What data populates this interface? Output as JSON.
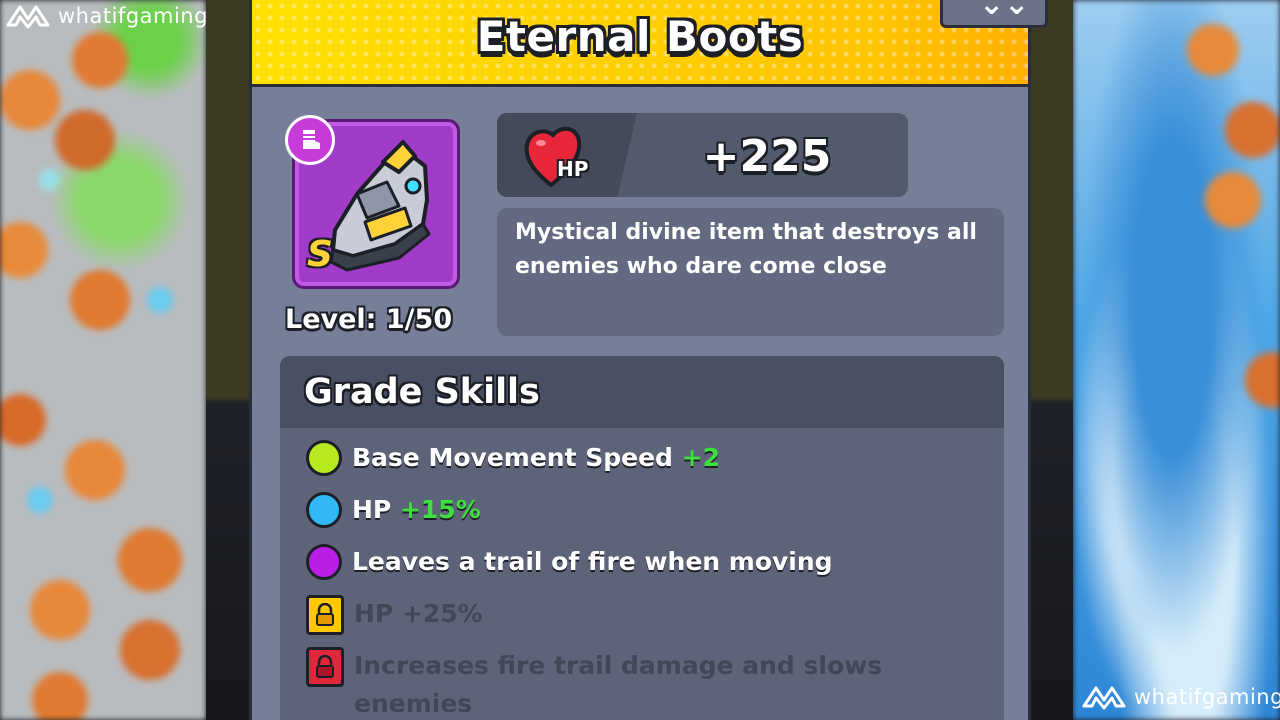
{
  "watermark": {
    "text": "whatifgaming"
  },
  "item": {
    "title": "Eternal Boots",
    "grade_letter": "S",
    "level_text": "Level: 1/50",
    "stat": {
      "icon": "heart-icon",
      "icon_label": "HP",
      "value": "+225"
    },
    "description": "Mystical divine item that destroys all enemies who dare come close"
  },
  "grade_skills": {
    "title": "Grade Skills",
    "skills": [
      {
        "text": "Base Movement Speed",
        "bonus": "+2",
        "dot_color": "#b6ea1f",
        "locked": false
      },
      {
        "text": "HP",
        "bonus": "+15%",
        "dot_color": "#2fb8f5",
        "locked": false
      },
      {
        "text": "Leaves a trail of fire when moving",
        "bonus": "",
        "dot_color": "#b81ee8",
        "locked": false
      },
      {
        "text": "HP +25%",
        "bonus": "",
        "lock_color": "#ffc800",
        "locked": true
      },
      {
        "text": "Increases fire trail damage and slows enemies",
        "bonus": "",
        "lock_color": "#e0283c",
        "locked": true
      }
    ]
  },
  "colors": {
    "panel": "#777f98",
    "header_yellow": "#ffd000",
    "card_purple": "#a13bc9",
    "bonus_green": "#3ee03e"
  }
}
